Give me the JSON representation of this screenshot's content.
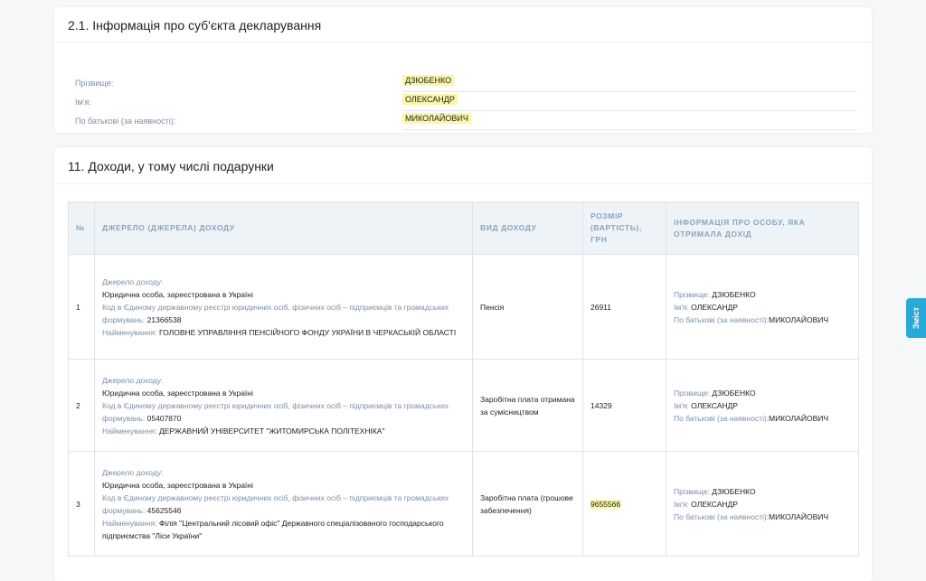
{
  "section1": {
    "title": "2.1. Інформація про суб'єкта декларування",
    "fields": [
      {
        "label": "Прізвище:",
        "value": "ДЗЮБЕНКО"
      },
      {
        "label": "Ім'я:",
        "value": "ОЛЕКСАНДР"
      },
      {
        "label": "По батькові (за наявності):",
        "value": "МИКОЛАЙОВИЧ"
      }
    ]
  },
  "section2": {
    "title": "11. Доходи, у тому числі подарунки",
    "headers": {
      "num": "№",
      "source": "Джерело (джерела) доходу",
      "type": "Вид доходу",
      "amount": "Розмір (вартість), грн",
      "person": "Інформація про особу, яка отримала дохід"
    },
    "labels": {
      "source": "Джерело доходу:",
      "code": "Код в Єдиному державному реєстрі юридичних осіб, фізичних осіб – підприємців та громадських формувань:",
      "name": "Найменування:",
      "surname": "Прізвище:",
      "first_name": "Ім'я:",
      "patronymic": "По батькові (за наявності):"
    },
    "rows": [
      {
        "num": "1",
        "entity": "Юридична особа, зареєстрована в Україні",
        "code": "21366538",
        "name": "ГОЛОВНЕ УПРАВЛІННЯ ПЕНСІЙНОГО ФОНДУ УКРАЇНИ В ЧЕРКАСЬКІЙ ОБЛАСТІ",
        "type": "Пенсія",
        "amount": "26911",
        "surname": "ДЗЮБЕНКО",
        "first_name": "ОЛЕКСАНДР",
        "patronymic": "МИКОЛАЙОВИЧ"
      },
      {
        "num": "2",
        "entity": "Юридична особа, зареєстрована в Україні",
        "code": "05407870",
        "name": "ДЕРЖАВНИЙ УНІВЕРСИТЕТ \"ЖИТОМИРСЬКА ПОЛІТЕХНІКА\"",
        "type": "Заробітна плата отримана за сумісництвом",
        "amount": "14329",
        "surname": "ДЗЮБЕНКО",
        "first_name": "ОЛЕКСАНДР",
        "patronymic": "МИКОЛАЙОВИЧ"
      },
      {
        "num": "3",
        "entity": "Юридична особа, зареєстрована в Україні",
        "code": "45625546",
        "name": "Філія \"Центральний лісовий офіс\" Державного спеціалізованого господарського підприємства \"Ліси України\"",
        "type": "Заробітна плата (грошове забезпечення)",
        "amount": "9655566",
        "surname": "ДЗЮБЕНКО",
        "first_name": "ОЛЕКСАНДР",
        "patronymic": "МИКОЛАЙОВИЧ"
      }
    ]
  },
  "toc_label": "Зміст"
}
